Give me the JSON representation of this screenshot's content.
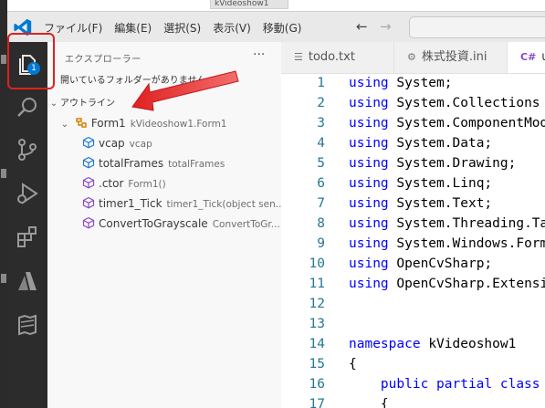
{
  "background_window": {
    "title_fragment": "kVideoshow1"
  },
  "titlebar": {
    "menu": [
      "ファイル(F)",
      "編集(E)",
      "選択(S)",
      "表示(V)",
      "移動(G)"
    ],
    "back_icon": "arrow-left-icon",
    "forward_icon": "arrow-right-icon"
  },
  "activity_bar": {
    "items": [
      "explorer-icon",
      "search-icon",
      "source-control-icon",
      "run-debug-icon",
      "extensions-icon",
      "azure-icon",
      "docs-icon"
    ],
    "explorer_badge": "1"
  },
  "sidebar": {
    "title": "エクスプローラー",
    "more": "···",
    "open_folder_section": "開いているフォルダーがありません",
    "outline_section": "アウトライン",
    "outline": [
      {
        "name": "Form1",
        "detail": "kVideoshow1.Form1",
        "kind": "class",
        "level": 1
      },
      {
        "name": "vcap",
        "detail": "vcap",
        "kind": "field",
        "level": 2
      },
      {
        "name": "totalFrames",
        "detail": "totalFrames",
        "kind": "field",
        "level": 2
      },
      {
        "name": ".ctor",
        "detail": "Form1()",
        "kind": "method",
        "level": 2
      },
      {
        "name": "timer1_Tick",
        "detail": "timer1_Tick(object sen...",
        "kind": "method",
        "level": 2
      },
      {
        "name": "ConvertToGrayscale",
        "detail": "ConvertToGr...",
        "kind": "method",
        "level": 2
      }
    ]
  },
  "editor": {
    "tabs": [
      {
        "label": "todo.txt",
        "icon": "text-file-icon",
        "active": false
      },
      {
        "label": "株式投資.ini",
        "icon": "settings-file-icon",
        "active": false
      },
      {
        "label": "u",
        "icon": "csharp-file-icon",
        "active": true
      }
    ],
    "lines": [
      {
        "n": "1",
        "kw": "using",
        "rest": "System;"
      },
      {
        "n": "2",
        "kw": "using",
        "rest": "System.Collections"
      },
      {
        "n": "3",
        "kw": "using",
        "rest": "System.ComponentMod"
      },
      {
        "n": "4",
        "kw": "using",
        "rest": "System.Data;"
      },
      {
        "n": "5",
        "kw": "using",
        "rest": "System.Drawing;"
      },
      {
        "n": "6",
        "kw": "using",
        "rest": "System.Linq;"
      },
      {
        "n": "7",
        "kw": "using",
        "rest": "System.Text;"
      },
      {
        "n": "8",
        "kw": "using",
        "rest": "System.Threading.Ta"
      },
      {
        "n": "9",
        "kw": "using",
        "rest": "System.Windows.Form"
      },
      {
        "n": "10",
        "kw": "using",
        "rest": "OpenCvSharp;"
      },
      {
        "n": "11",
        "kw": "using",
        "rest": "OpenCvSharp.Extensi"
      },
      {
        "n": "12",
        "kw": "",
        "rest": ""
      },
      {
        "n": "13",
        "kw": "",
        "rest": ""
      },
      {
        "n": "14",
        "kw": "namespace",
        "rest": "kVideoshow1"
      },
      {
        "n": "15",
        "kw": "",
        "rest": "{"
      },
      {
        "n": "16",
        "kw": "    public partial class",
        "rest": ""
      },
      {
        "n": "17",
        "kw": "",
        "rest": "    {"
      }
    ]
  },
  "annotation": {
    "highlight_color": "#e02020",
    "arrow_color": "#e02020"
  },
  "colors": {
    "activity_bar": "#2c2c2c",
    "sidebar": "#f8f8f8",
    "keyword": "#0000ff",
    "line_number": "#237893",
    "accent": "#0078d4"
  }
}
